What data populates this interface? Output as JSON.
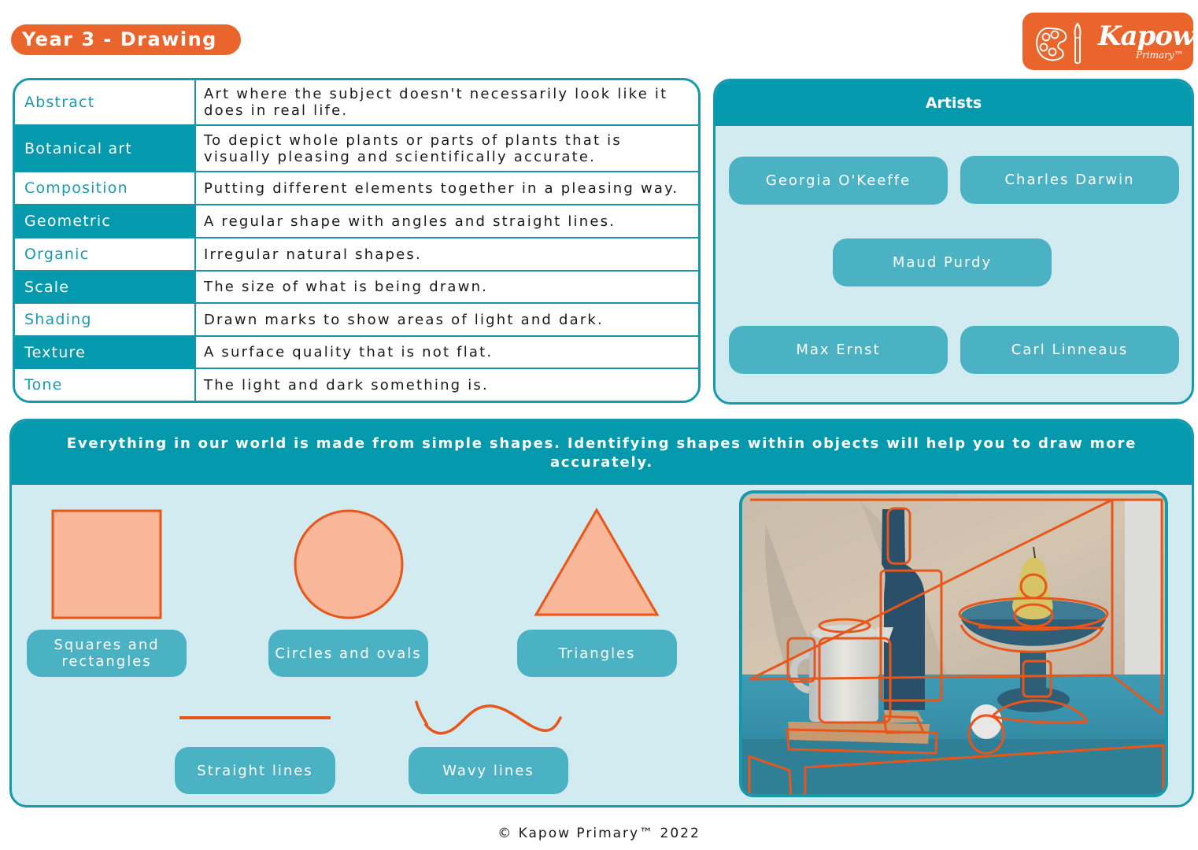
{
  "header": {
    "title": "Year 3 - Drawing",
    "logo": {
      "word": "Kapow",
      "sub": "Primary™",
      "icon": "palette-brush-icon"
    }
  },
  "colors": {
    "brand_orange": "#e9652b",
    "teal_dark": "#0499ad",
    "teal_chip": "#4bb2c4",
    "panel_bg": "#d1ebf0",
    "shape_fill": "#f8b799",
    "shape_stroke": "#e8561a"
  },
  "glossary": [
    {
      "term": "Abstract",
      "definition": "Art where the subject doesn't necessarily look like it does in real life.",
      "style": "light"
    },
    {
      "term": "Botanical art",
      "definition": "To depict whole plants or parts of plants that is visually pleasing and scientifically accurate.",
      "style": "dark"
    },
    {
      "term": "Composition",
      "definition": "Putting different elements together in a pleasing way.",
      "style": "light"
    },
    {
      "term": "Geometric",
      "definition": "A regular shape with angles and straight lines.",
      "style": "dark"
    },
    {
      "term": "Organic",
      "definition": "Irregular natural shapes.",
      "style": "light"
    },
    {
      "term": "Scale",
      "definition": "The size of what is being drawn.",
      "style": "dark"
    },
    {
      "term": "Shading",
      "definition": "Drawn marks to show areas of light and dark.",
      "style": "light"
    },
    {
      "term": "Texture",
      "definition": "A surface quality that is not flat.",
      "style": "dark"
    },
    {
      "term": "Tone",
      "definition": "The light and dark something is.",
      "style": "light"
    }
  ],
  "artists": {
    "heading": "Artists",
    "names": [
      "Georgia O'Keeffe",
      "Charles Darwin",
      "Maud Purdy",
      "Max Ernst",
      "Carl Linneaus"
    ]
  },
  "shapes": {
    "intro": "Everything in our world is made from simple shapes. Identifying shapes within objects will help you to draw more accurately.",
    "labels": {
      "square": "Squares and rectangles",
      "circle": "Circles and ovals",
      "triangle": "Triangles",
      "straight": "Straight lines",
      "wavy": "Wavy lines"
    },
    "painting": "still-life-painting-with-shape-outlines"
  },
  "footer": {
    "copyright": "© Kapow Primary™ 2022"
  }
}
